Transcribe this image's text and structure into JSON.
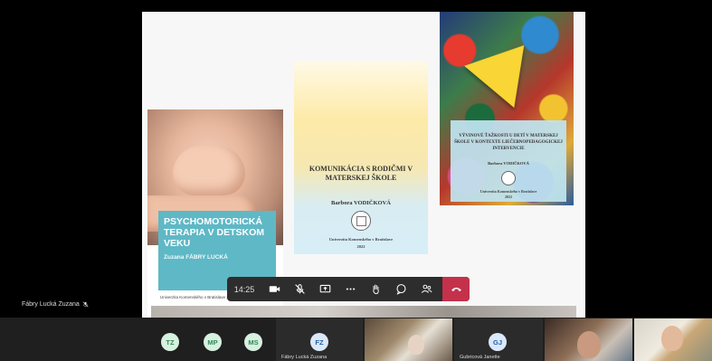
{
  "books": [
    {
      "title": "PSYCHOMOTORICKÁ TERAPIA V DETSKOM VEKU",
      "author": "Zuzana FÁBRY LUCKÁ",
      "footer": "Univerzita Komenského v Bratislave 2021"
    },
    {
      "title": "KOMUNIKÁCIA S RODIČMI V MATERSKEJ ŠKOLE",
      "author": "Barbora VODIČKOVÁ",
      "publisher": "Univerzita Komenského v Bratislave",
      "year": "2022"
    },
    {
      "title": "VÝVINOVÉ ŤAŽKOSTI U DETÍ V MATERSKEJ ŠKOLE V KONTEXTE LIEČEBNOPEDAGOGICKEJ INTERVENCIE",
      "author": "Barbora VODIČKOVÁ",
      "publisher": "Univerzita Komenského v Bratislave",
      "year": "2022"
    }
  ],
  "controls": {
    "time": "14:25"
  },
  "presenter": {
    "name": "Fábry Lucká Zuzana"
  },
  "participants": [
    {
      "initials": "TZ",
      "color": "#2e8b57",
      "bg": "#d8f0e0"
    },
    {
      "initials": "MP",
      "color": "#2e8b57",
      "bg": "#d8f0e0"
    },
    {
      "initials": "MS",
      "color": "#2e8b57",
      "bg": "#d8f0e0"
    },
    {
      "initials": "FZ",
      "color": "#1f5fa8",
      "bg": "#dbe8f8",
      "name": "Fábry Lucká Zuzana"
    },
    {
      "initials": "GJ",
      "color": "#1f5fa8",
      "bg": "#dbe8f8",
      "name": "Gubricová Janette"
    }
  ]
}
